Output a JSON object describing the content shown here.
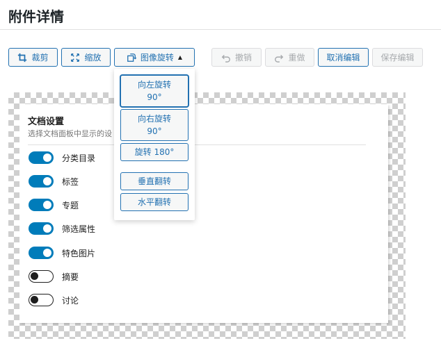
{
  "page_title": "附件详情",
  "toolbar": {
    "crop": "裁剪",
    "scale": "缩放",
    "rotate": "图像旋转",
    "undo": "撤销",
    "redo": "重做",
    "cancel": "取消编辑",
    "save": "保存编辑"
  },
  "rotate_menu": {
    "rotate_left": "向左旋转",
    "rotate_left_deg": "90°",
    "rotate_right": "向右旋转",
    "rotate_right_deg": "90°",
    "rotate_180": "旋转 180°",
    "flip_vertical": "垂直翻转",
    "flip_horizontal": "水平翻转"
  },
  "image_preview": {
    "heading": "文档设置",
    "description": "选择文档面板中显示的设",
    "options": [
      {
        "label": "分类目录",
        "enabled": true
      },
      {
        "label": "标签",
        "enabled": true
      },
      {
        "label": "专题",
        "enabled": true
      },
      {
        "label": "筛选属性",
        "enabled": true
      },
      {
        "label": "特色图片",
        "enabled": true
      },
      {
        "label": "摘要",
        "enabled": false
      },
      {
        "label": "讨论",
        "enabled": false
      }
    ]
  },
  "colors": {
    "accent": "#2271b1",
    "toggle_on": "#007cba",
    "disabled": "#a7aaad"
  }
}
